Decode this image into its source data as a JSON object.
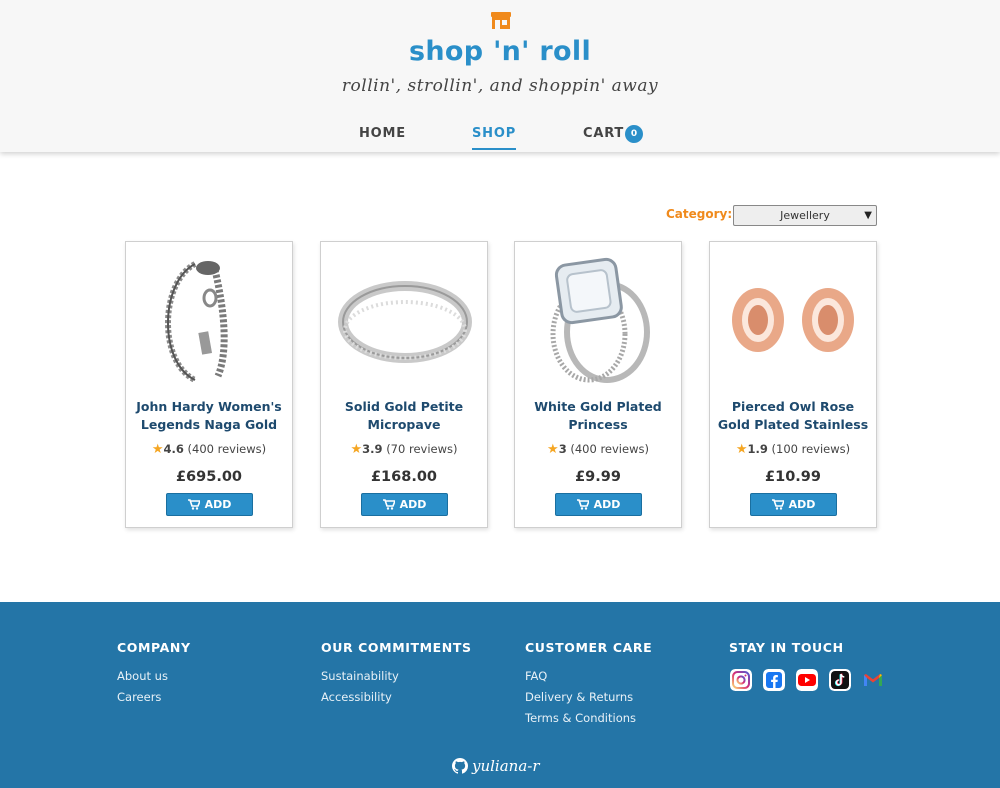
{
  "header": {
    "brand": "shop 'n' roll",
    "tagline": "rollin', strollin', and shoppin' away",
    "nav": {
      "home": "HOME",
      "shop": "SHOP",
      "cart": "CART"
    },
    "cart_count": "0"
  },
  "filter": {
    "label": "Category:",
    "selected": "Jewellery"
  },
  "products": [
    {
      "title": "John Hardy Women's Legends Naga Gold &…",
      "rating": "4.6",
      "reviews": "(400 reviews)",
      "price": "£695.00",
      "add": "ADD"
    },
    {
      "title": "Solid Gold Petite Micropave",
      "rating": "3.9",
      "reviews": "(70 reviews)",
      "price": "£168.00",
      "add": "ADD"
    },
    {
      "title": "White Gold Plated Princess",
      "rating": "3",
      "reviews": "(400 reviews)",
      "price": "£9.99",
      "add": "ADD"
    },
    {
      "title": "Pierced Owl Rose Gold Plated Stainless Steel…",
      "rating": "1.9",
      "reviews": "(100 reviews)",
      "price": "£10.99",
      "add": "ADD"
    }
  ],
  "footer": {
    "company": {
      "title": "COMPANY",
      "links": [
        "About us",
        "Careers"
      ]
    },
    "commitments": {
      "title": "OUR COMMITMENTS",
      "links": [
        "Sustainability",
        "Accessibility"
      ]
    },
    "care": {
      "title": "CUSTOMER CARE",
      "links": [
        "FAQ",
        "Delivery & Returns",
        "Terms & Conditions"
      ]
    },
    "stay": {
      "title": "STAY IN TOUCH",
      "icons": [
        "instagram-icon",
        "facebook-icon",
        "youtube-icon",
        "tiktok-icon",
        "gmail-icon"
      ]
    },
    "credit": "yuliana-r"
  },
  "colors": {
    "primary": "#2a8fc9",
    "accent": "#f08a1c",
    "footer": "#2475a7",
    "star": "#f5a623"
  }
}
